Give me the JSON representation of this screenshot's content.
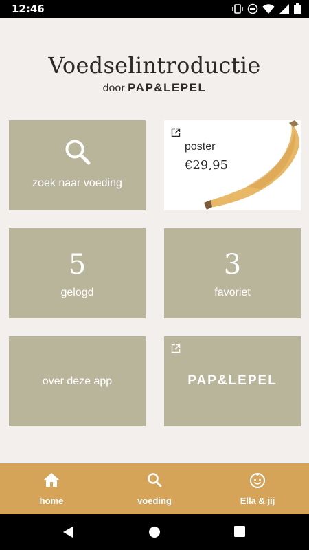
{
  "status_bar": {
    "time": "12:46"
  },
  "header": {
    "title": "Voedselintroductie",
    "byline_prefix": "door",
    "brand": "PAP&LEPEL"
  },
  "tiles": {
    "search": {
      "label": "zoek naar voeding",
      "icon": "search-icon"
    },
    "poster": {
      "title": "poster",
      "price": "€29,95",
      "icon": "external-link-icon"
    },
    "logged": {
      "number": "5",
      "label": "gelogd"
    },
    "favorites": {
      "number": "3",
      "label": "favoriet"
    },
    "about": {
      "label": "over deze app"
    },
    "brand": {
      "label": "PAP&LEPEL",
      "icon": "external-link-icon"
    }
  },
  "bottom_nav": {
    "items": [
      {
        "label": "home",
        "icon": "home-icon"
      },
      {
        "label": "voeding",
        "icon": "search-icon"
      },
      {
        "label": "Ella & jij",
        "icon": "baby-face-icon"
      }
    ]
  },
  "colors": {
    "tile": "#b8b59b",
    "nav": "#d5a458",
    "background": "#f2efec"
  }
}
